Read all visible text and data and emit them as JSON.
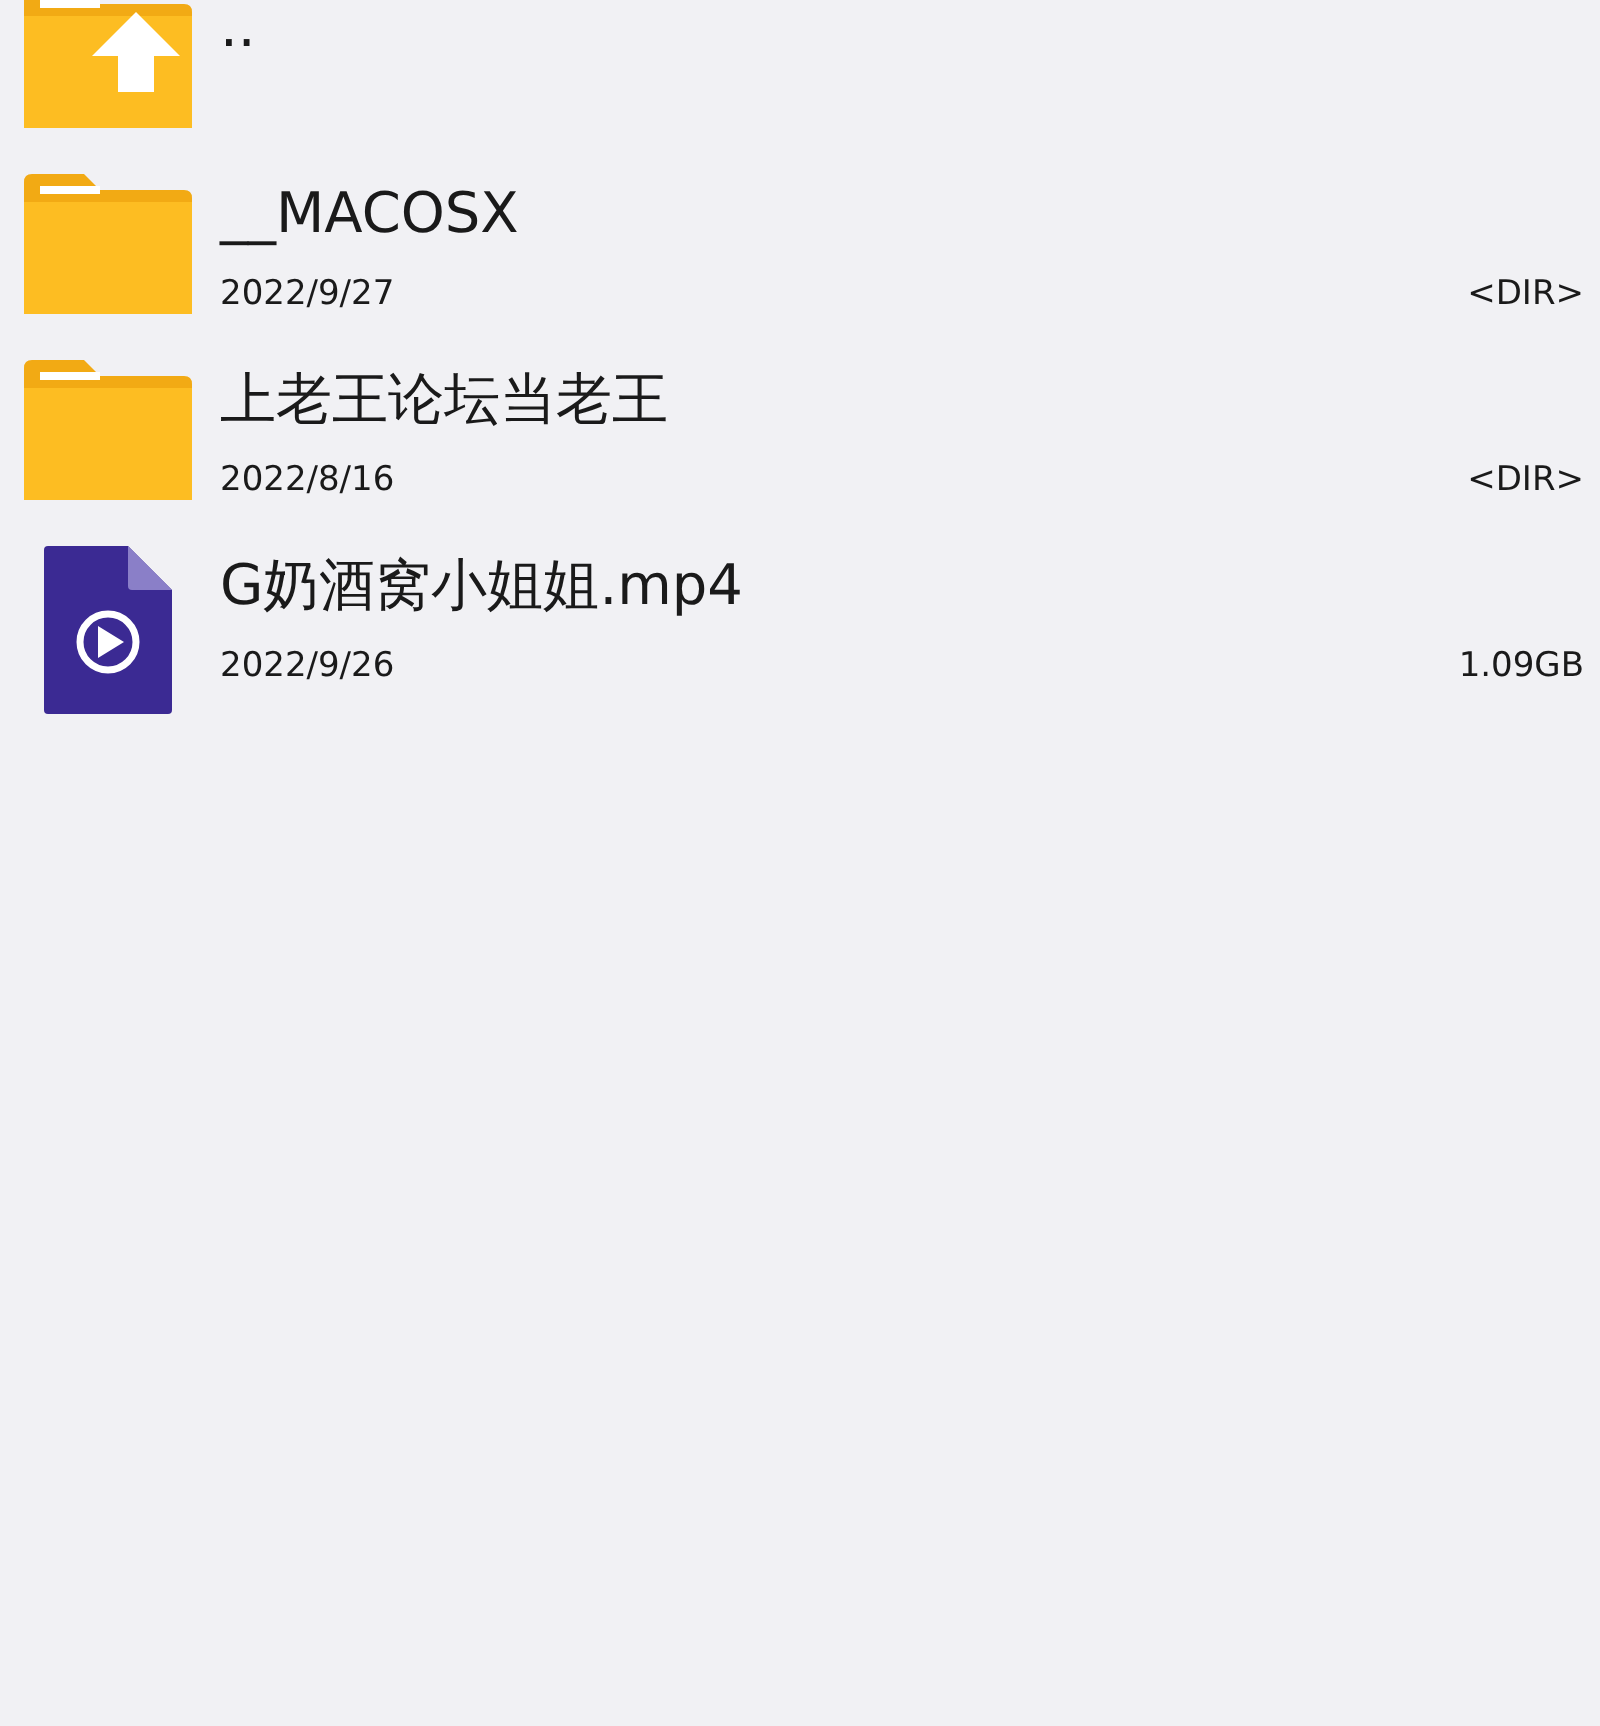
{
  "files": [
    {
      "kind": "up",
      "name": ".."
    },
    {
      "kind": "folder",
      "name": "__MACOSX",
      "date": "2022/9/27",
      "size": "<DIR>"
    },
    {
      "kind": "folder",
      "name": "上老王论坛当老王",
      "date": "2022/8/16",
      "size": "<DIR>"
    },
    {
      "kind": "video",
      "name": "G奶酒窝小姐姐.mp4",
      "date": "2022/9/26",
      "size": "1.09GB"
    }
  ]
}
